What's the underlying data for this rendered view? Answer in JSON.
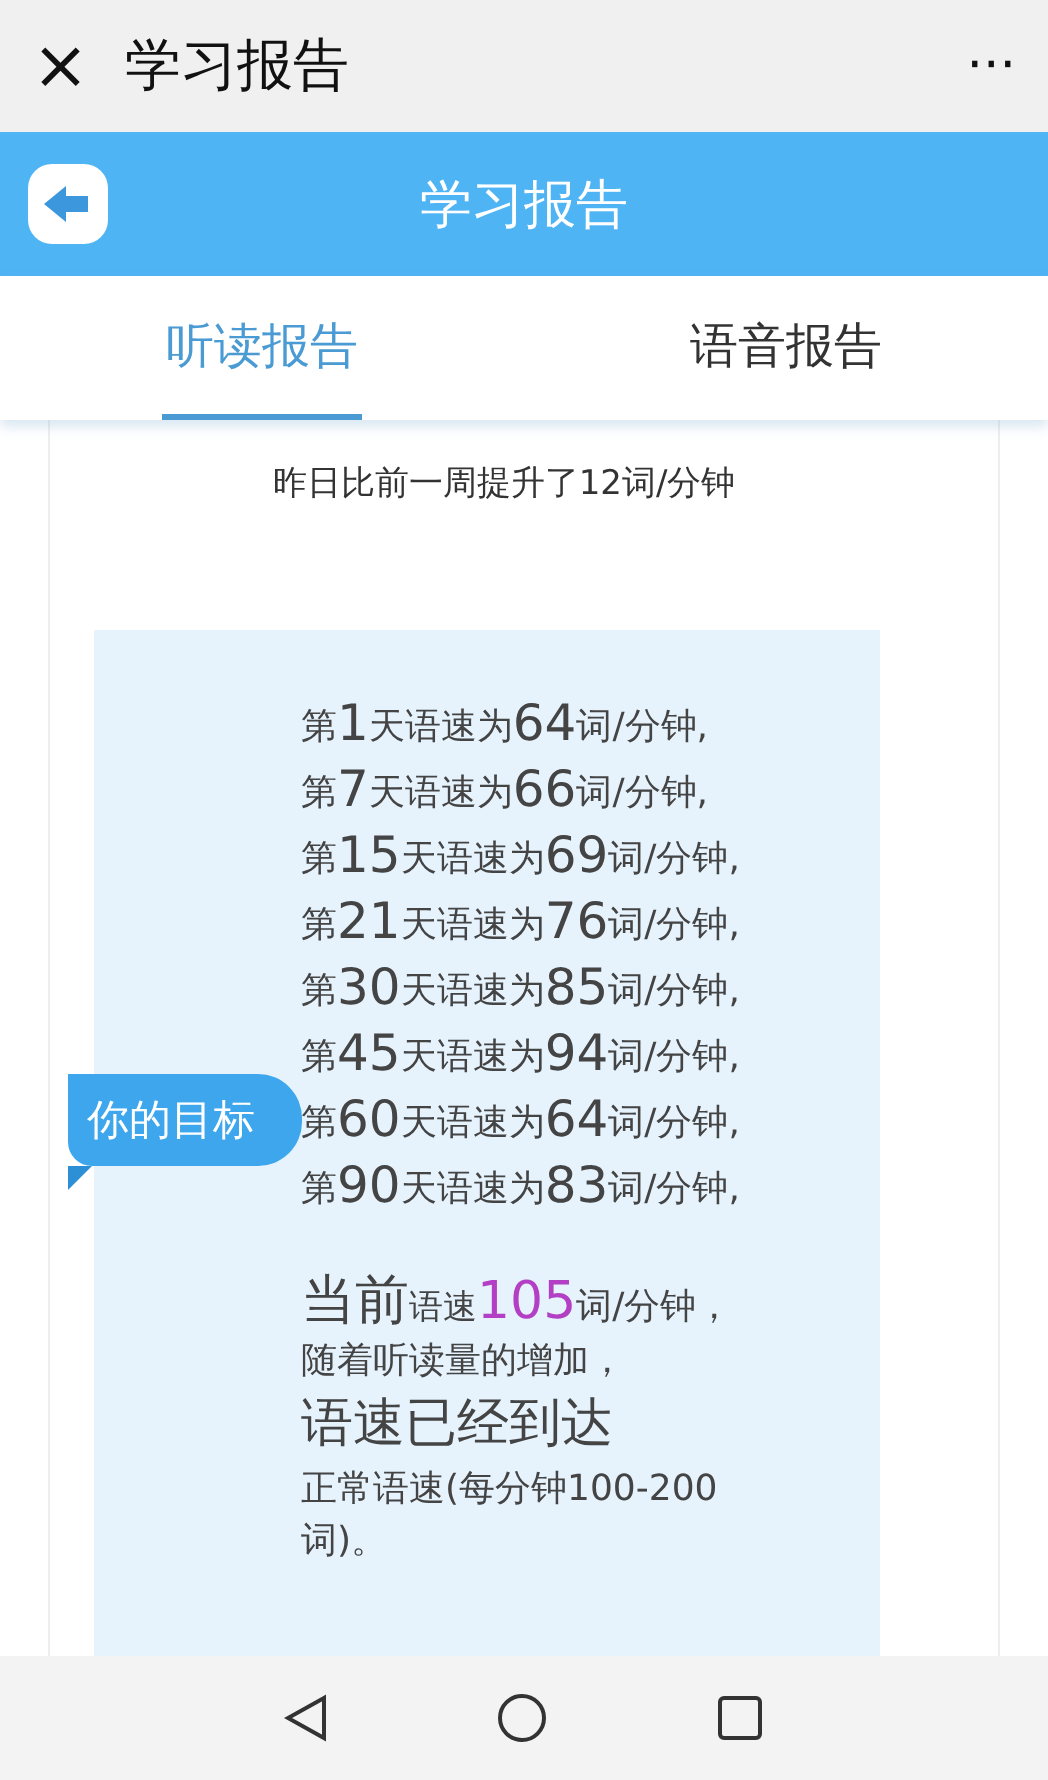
{
  "top_bar": {
    "close": "×",
    "title": "学习报告",
    "more": "···"
  },
  "header": {
    "title": "学习报告"
  },
  "tabs": [
    {
      "label": "听读报告",
      "selected": true
    },
    {
      "label": "语音报告",
      "selected": false
    }
  ],
  "summary": "昨日比前一周提升了12词/分钟",
  "goal": {
    "badge": "你的目标",
    "lines": [
      "第1天语速为64词/分钟,",
      "第7天语速为66词/分钟,",
      "第15天语速为69词/分钟,",
      "第21天语速为76词/分钟,",
      "第30天语速为85词/分钟,",
      "第45天语速为94词/分钟,",
      "第60天语速为64词/分钟,",
      "第90天语速为83词/分钟,"
    ],
    "current": [
      {
        "text": "当前",
        "kind": "large"
      },
      {
        "text": "语速",
        "kind": "small"
      },
      {
        "text": "105",
        "kind": "highlight"
      },
      {
        "text": "词/分钟，",
        "kind": "normal"
      }
    ],
    "notes": [
      {
        "text": "随着听读量的增加，",
        "kind": "normal"
      },
      {
        "text": "语速已经到达",
        "kind": "large"
      },
      {
        "text": "正常语速(每分钟100-200词)。",
        "kind": "normal"
      }
    ]
  }
}
